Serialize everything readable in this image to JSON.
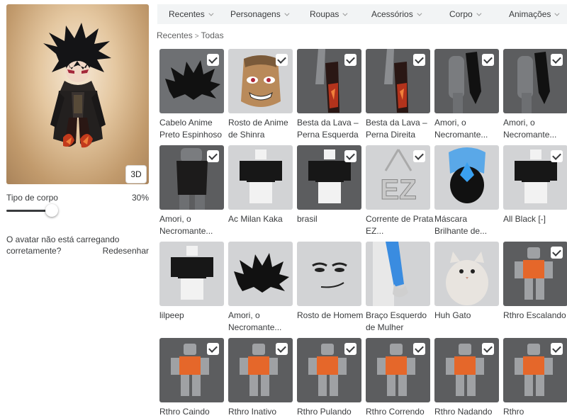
{
  "tabs": [
    {
      "label": "Recentes"
    },
    {
      "label": "Personagens"
    },
    {
      "label": "Roupas"
    },
    {
      "label": "Acessórios"
    },
    {
      "label": "Corpo"
    },
    {
      "label": "Animações"
    }
  ],
  "breadcrumb": {
    "first": "Recentes",
    "separator": ">",
    "second": "Todas"
  },
  "preview": {
    "view_button": "3D"
  },
  "body_type": {
    "label": "Tipo de corpo",
    "value_text": "30%",
    "value": 0.3
  },
  "warning": {
    "line1": "O avatar não está carregando",
    "line2": "corretamente?",
    "action": "Redesenhar"
  },
  "items": [
    {
      "name": "Cabelo Anime Preto Espinhoso",
      "selected": true,
      "thumb": "hair-icon"
    },
    {
      "name": "Rosto de Anime de Shinra",
      "selected": true,
      "thumb": "face-head-icon"
    },
    {
      "name": "Besta da Lava – Perna Esquerda",
      "selected": true,
      "thumb": "lava-leg-icon"
    },
    {
      "name": "Besta da Lava – Perna Direita",
      "selected": true,
      "thumb": "lava-leg-icon"
    },
    {
      "name": "Amori, o Necromante...",
      "selected": true,
      "thumb": "dark-arm-icon"
    },
    {
      "name": "Amori, o Necromante...",
      "selected": true,
      "thumb": "dark-arm-icon"
    },
    {
      "name": "Amori, o Necromante...",
      "selected": true,
      "thumb": "dark-torso-icon"
    },
    {
      "name": "Ac Milan Kaka",
      "selected": false,
      "thumb": "shirt-icon"
    },
    {
      "name": "brasil",
      "selected": true,
      "thumb": "shirt-icon"
    },
    {
      "name": "Corrente de Prata EZ...",
      "selected": true,
      "thumb": "chain-icon"
    },
    {
      "name": "Máscara Brilhante de...",
      "selected": false,
      "thumb": "mask-icon"
    },
    {
      "name": "All Black [-]",
      "selected": true,
      "thumb": "shirt-icon"
    },
    {
      "name": "lilpeep",
      "selected": false,
      "thumb": "shirt-icon"
    },
    {
      "name": "Amori, o Necromante...",
      "selected": false,
      "thumb": "hair-icon"
    },
    {
      "name": "Rosto de Homem",
      "selected": false,
      "thumb": "face-icon"
    },
    {
      "name": "Braço Esquerdo de Mulher",
      "selected": false,
      "thumb": "arm-icon"
    },
    {
      "name": "Huh Gato",
      "selected": false,
      "thumb": "cat-icon"
    },
    {
      "name": "Rthro Escalando",
      "selected": true,
      "thumb": "animation-icon"
    },
    {
      "name": "Rthro Caindo",
      "selected": true,
      "thumb": "animation-icon"
    },
    {
      "name": "Rthro Inativo",
      "selected": true,
      "thumb": "animation-icon"
    },
    {
      "name": "Rthro Pulando",
      "selected": true,
      "thumb": "animation-icon"
    },
    {
      "name": "Rthro Correndo",
      "selected": true,
      "thumb": "animation-icon"
    },
    {
      "name": "Rthro Nadando",
      "selected": true,
      "thumb": "animation-icon"
    },
    {
      "name": "Rthro",
      "selected": true,
      "thumb": "animation-icon"
    }
  ]
}
